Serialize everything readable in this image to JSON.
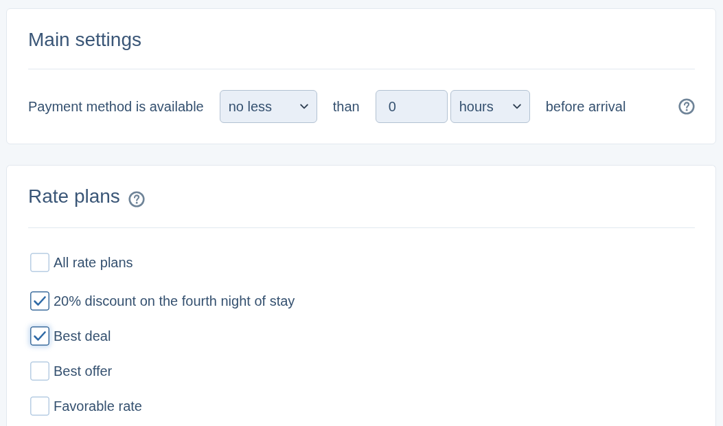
{
  "main_settings": {
    "title": "Main settings",
    "availability": {
      "label": "Payment method is available",
      "comparison": {
        "value": "no less"
      },
      "connector": "than",
      "amount": {
        "value": "0"
      },
      "unit": {
        "value": "hours"
      },
      "suffix": "before arrival"
    }
  },
  "rate_plans": {
    "title": "Rate plans",
    "items": [
      {
        "label": "All rate plans",
        "checked": false,
        "focused": false
      },
      {
        "label": "20% discount on the fourth night of stay",
        "checked": true,
        "focused": false
      },
      {
        "label": "Best deal",
        "checked": true,
        "focused": true
      },
      {
        "label": "Best offer",
        "checked": false,
        "focused": false
      },
      {
        "label": "Favorable rate",
        "checked": false,
        "focused": false
      }
    ]
  }
}
